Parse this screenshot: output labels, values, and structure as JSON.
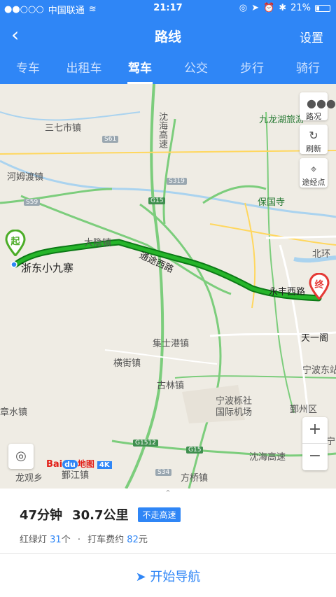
{
  "status": {
    "carrier": "中国联通",
    "time": "21:17",
    "battery": "21%"
  },
  "navbar": {
    "back_icon": "chevron-left-icon",
    "title": "路线",
    "settings": "设置"
  },
  "tabs": [
    "专车",
    "出租车",
    "驾车",
    "公交",
    "步行",
    "骑行"
  ],
  "active_tab": "驾车",
  "map": {
    "controls": {
      "traffic": "路况",
      "refresh": "刷新",
      "waypoint": "途经点"
    },
    "labels": {
      "l1": "三七市镇",
      "l2": "沈海高速",
      "l3": "九龙湖旅游",
      "l4": "河姆渡镇",
      "l5": "保国寺",
      "l6": "大隐镇",
      "l7": "浙东小九寨",
      "l8": "通途西路",
      "l9": "永丰西路",
      "l10": "天一阁",
      "l11": "集士港镇",
      "l12": "横街镇",
      "l13": "古林镇",
      "l14": "宁波栎社国际机场",
      "l15": "宁波东站",
      "l16": "鄞州区",
      "l17": "章水镇",
      "l18": "鄞江镇",
      "l19": "方桥镇",
      "l20": "沈海高速",
      "l21": "北环",
      "l22": "龙观乡",
      "l23": "宁"
    },
    "shields": {
      "s1": "S61",
      "s2": "S319",
      "s3": "G15",
      "s4": "S59",
      "s5": "G1512",
      "s6": "G15",
      "s7": "S34"
    },
    "start_marker": "起",
    "end_marker": "终",
    "zoom_in": "+",
    "zoom_out": "−",
    "logo": {
      "bai": "Bai",
      "du": "du",
      "ditu": "地图",
      "k": "4K"
    }
  },
  "route": {
    "duration": "47分钟",
    "distance": "30.7公里",
    "tag": "不走高速",
    "lights_label": "红绿灯",
    "lights_count": "31",
    "lights_unit": "个",
    "taxi_label": "打车费约",
    "taxi_fare": "82",
    "taxi_unit": "元",
    "start_nav": "开始导航"
  }
}
